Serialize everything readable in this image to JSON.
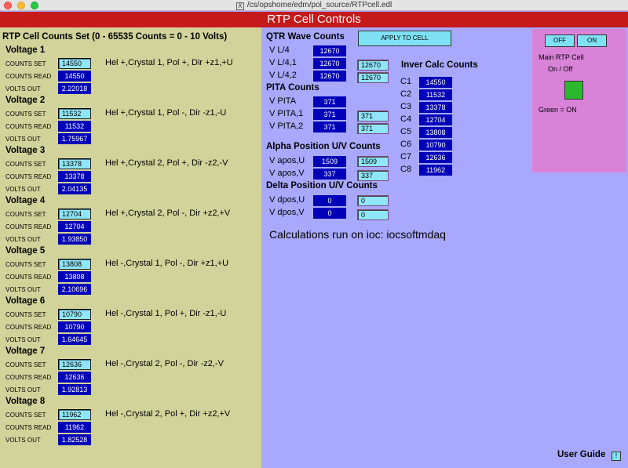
{
  "window": {
    "title": "/cs/opshome/edm/pol_source/RTPcell.edl",
    "header": "RTP Cell Controls"
  },
  "left": {
    "title": "RTP Cell Counts Set (0 - 65535 Counts = 0 - 10 Volts)",
    "labels": {
      "set": "COUNTS SET",
      "read": "COUNTS READ",
      "volts": "VOLTS OUT"
    },
    "voltages": [
      {
        "name": "Voltage 1",
        "set": "14550",
        "read": "14550",
        "volts": "2.22018",
        "desc": "Hel +,Crystal 1, Pol +, Dir +z1,+U"
      },
      {
        "name": "Voltage 2",
        "set": "11532",
        "read": "11532",
        "volts": "1.75967",
        "desc": "Hel +,Crystal 1, Pol -, Dir -z1,-U"
      },
      {
        "name": "Voltage 3",
        "set": "13378",
        "read": "13378",
        "volts": "2.04135",
        "desc": "Hel +,Crystal 2, Pol +, Dir -z2,-V"
      },
      {
        "name": "Voltage 4",
        "set": "12704",
        "read": "12704",
        "volts": "1.93850",
        "desc": "Hel +,Crystal 2, Pol -, Dir +z2,+V"
      },
      {
        "name": "Voltage 5",
        "set": "13808",
        "read": "13808",
        "volts": "2.10696",
        "desc": "Hel -,Crystal 1, Pol -, Dir +z1,+U"
      },
      {
        "name": "Voltage 6",
        "set": "10790",
        "read": "10790",
        "volts": "1.64645",
        "desc": "Hel -,Crystal 1, Pol +, Dir -z1,-U"
      },
      {
        "name": "Voltage 7",
        "set": "12636",
        "read": "12636",
        "volts": "1.92813",
        "desc": "Hel -,Crystal 2, Pol -, Dir -z2,-V"
      },
      {
        "name": "Voltage 8",
        "set": "11962",
        "read": "11962",
        "volts": "1.82528",
        "desc": "Hel -,Crystal 2, Pol +, Dir +z2,+V"
      }
    ]
  },
  "qtr": {
    "title": "QTR Wave Counts",
    "apply_label": "APPLY TO CELL",
    "rows": [
      {
        "label": "V L/4",
        "read": "12670",
        "input": ""
      },
      {
        "label": "V L/4,1",
        "read": "12670",
        "input": "12670"
      },
      {
        "label": "V L/4,2",
        "read": "12670",
        "input": "12670"
      }
    ]
  },
  "pita": {
    "title": "PITA Counts",
    "rows": [
      {
        "label": "V PITA",
        "read": "371",
        "input": ""
      },
      {
        "label": "V PITA,1",
        "read": "371",
        "input": "371"
      },
      {
        "label": "V PITA,2",
        "read": "371",
        "input": "371"
      }
    ]
  },
  "alpha": {
    "title": "Alpha Position U/V Counts",
    "rows": [
      {
        "label": "V apos,U",
        "read": "1509",
        "input": "1509"
      },
      {
        "label": "V apos,V",
        "read": "337",
        "input": "337"
      }
    ]
  },
  "delta": {
    "title": "Delta Position U/V Counts",
    "rows": [
      {
        "label": "V dpos,U",
        "read": "0",
        "input": "0"
      },
      {
        "label": "V dpos,V",
        "read": "0",
        "input": "0"
      }
    ]
  },
  "inver": {
    "title": "Inver Calc Counts",
    "rows": [
      {
        "label": "C1",
        "value": "14550"
      },
      {
        "label": "C2",
        "value": "11532"
      },
      {
        "label": "C3",
        "value": "13378"
      },
      {
        "label": "C4",
        "value": "12704"
      },
      {
        "label": "C5",
        "value": "13808"
      },
      {
        "label": "C6",
        "value": "10790"
      },
      {
        "label": "C7",
        "value": "12636"
      },
      {
        "label": "C8",
        "value": "11962"
      }
    ]
  },
  "calc_text": "Calculations run on ioc: iocsoftmdaq",
  "main_cell": {
    "off_label": "OFF",
    "on_label": "ON",
    "title_line1": "Main RTP Cell",
    "title_line2": "On / Off",
    "status_text": "Green = ON",
    "status_color": "#2cb82c"
  },
  "user_guide": {
    "label": "User Guide",
    "button": "!"
  }
}
